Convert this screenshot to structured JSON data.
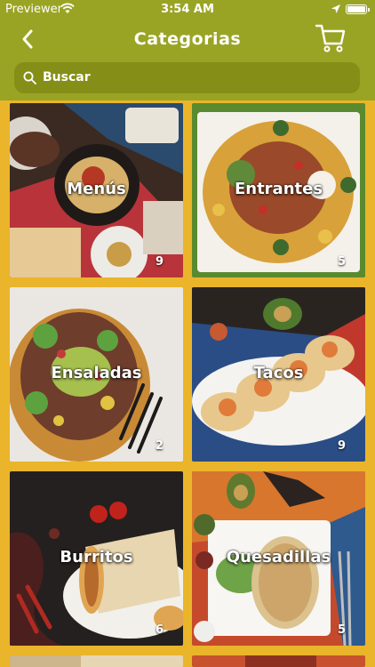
{
  "status_bar": {
    "carrier": "Previewer",
    "time": "3:54 AM"
  },
  "nav": {
    "title": "Categorias",
    "back_icon": "chevron-left-icon",
    "cart_icon": "cart-icon"
  },
  "search": {
    "placeholder": "Buscar"
  },
  "categories": [
    {
      "name": "Menús",
      "count": "9"
    },
    {
      "name": "Entrantes",
      "count": "5"
    },
    {
      "name": "Ensaladas",
      "count": "2"
    },
    {
      "name": "Tacos",
      "count": "9"
    },
    {
      "name": "Burritos",
      "count": "6"
    },
    {
      "name": "Quesadillas",
      "count": "5"
    }
  ],
  "colors": {
    "header_green": "#9aa424",
    "search_green": "#858f17",
    "background_yellow": "#eab52a"
  }
}
